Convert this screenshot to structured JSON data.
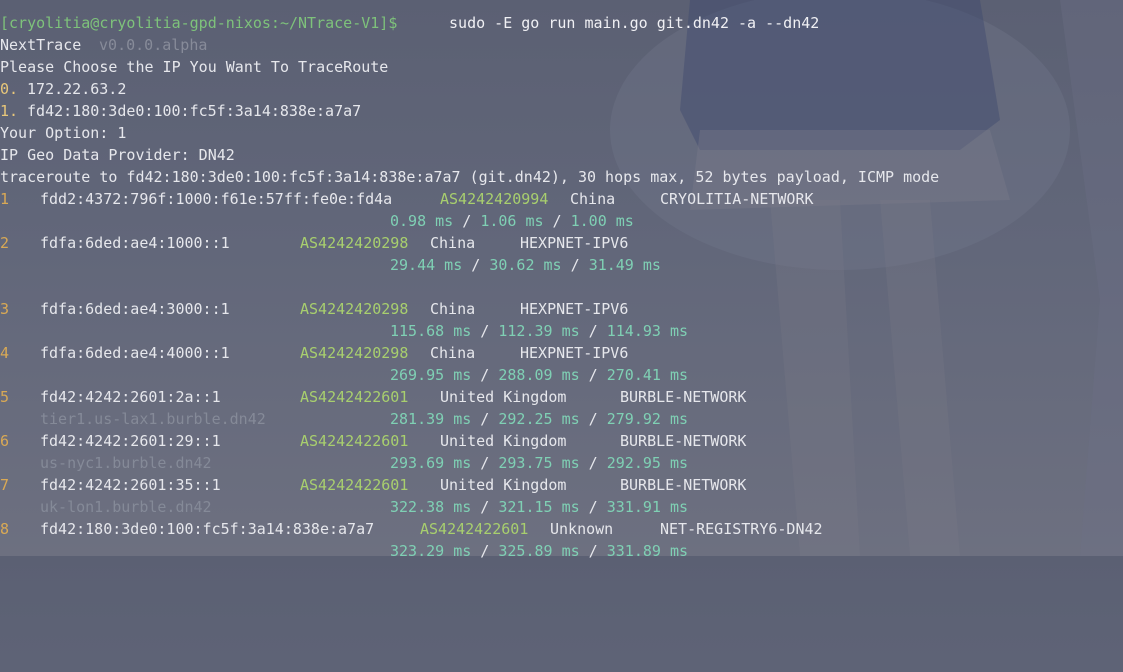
{
  "colors": {
    "prompt": "#7ec27b",
    "asn": "#a8cf6e",
    "rtt": "#7fd0b4",
    "hop_number": "#d9a955",
    "option_index": "#e8c77a"
  },
  "terminal": {
    "prompt": "[cryolitia@cryolitia-gpd-nixos:~/NTrace-V1]$",
    "command": " sudo -E go run main.go git.dn42 -a --dn42",
    "app_name": "NextTrace",
    "app_version": " v0.0.0.alpha",
    "choose_prompt": "Please Choose the IP You Want To TraceRoute",
    "options": [
      {
        "index": "0.",
        "address": " 172.22.63.2"
      },
      {
        "index": "1.",
        "address": " fd42:180:3de0:100:fc5f:3a14:838e:a7a7"
      }
    ],
    "your_option": "Your Option: 1",
    "geo_provider": "IP Geo Data Provider: DN42",
    "traceroute_header": "traceroute to fd42:180:3de0:100:fc5f:3a14:838e:a7a7 (git.dn42), 30 hops max, 52 bytes payload, ICMP mode",
    "hops": [
      {
        "num": "1",
        "ip": "fdd2:4372:796f:1000:f61e:57ff:fe0e:fd4a",
        "asn": "AS4242420994",
        "country": "China",
        "network": "CRYOLITIA-NETWORK",
        "ptr": "",
        "rtt": [
          "0.98 ms",
          "1.06 ms",
          "1.00 ms"
        ]
      },
      {
        "num": "2",
        "ip": "fdfa:6ded:ae4:1000::1",
        "asn": "AS4242420298",
        "country": "China",
        "network": "HEXPNET-IPV6",
        "ptr": "",
        "rtt": [
          "29.44 ms",
          "30.62 ms",
          "31.49 ms"
        ]
      },
      {
        "num": "3",
        "ip": "fdfa:6ded:ae4:3000::1",
        "asn": "AS4242420298",
        "country": "China",
        "network": "HEXPNET-IPV6",
        "ptr": "",
        "rtt": [
          "115.68 ms",
          "112.39 ms",
          "114.93 ms"
        ]
      },
      {
        "num": "4",
        "ip": "fdfa:6ded:ae4:4000::1",
        "asn": "AS4242420298",
        "country": "China",
        "network": "HEXPNET-IPV6",
        "ptr": "",
        "rtt": [
          "269.95 ms",
          "288.09 ms",
          "270.41 ms"
        ]
      },
      {
        "num": "5",
        "ip": "fd42:4242:2601:2a::1",
        "asn": "AS4242422601",
        "country": "United Kingdom",
        "network": "BURBLE-NETWORK",
        "ptr": "tier1.us-lax1.burble.dn42",
        "rtt": [
          "281.39 ms",
          "292.25 ms",
          "279.92 ms"
        ]
      },
      {
        "num": "6",
        "ip": "fd42:4242:2601:29::1",
        "asn": "AS4242422601",
        "country": "United Kingdom",
        "network": "BURBLE-NETWORK",
        "ptr": "us-nyc1.burble.dn42",
        "rtt": [
          "293.69 ms",
          "293.75 ms",
          "292.95 ms"
        ]
      },
      {
        "num": "7",
        "ip": "fd42:4242:2601:35::1",
        "asn": "AS4242422601",
        "country": "United Kingdom",
        "network": "BURBLE-NETWORK",
        "ptr": "uk-lon1.burble.dn42",
        "rtt": [
          "322.38 ms",
          "321.15 ms",
          "331.91 ms"
        ]
      },
      {
        "num": "8",
        "ip": "fd42:180:3de0:100:fc5f:3a14:838e:a7a7",
        "asn": "AS4242422601",
        "country": "Unknown",
        "network": "NET-REGISTRY6-DN42",
        "ptr": "",
        "rtt": [
          "323.29 ms",
          "325.89 ms",
          "331.89 ms"
        ]
      }
    ],
    "rtt_separator": " / "
  }
}
